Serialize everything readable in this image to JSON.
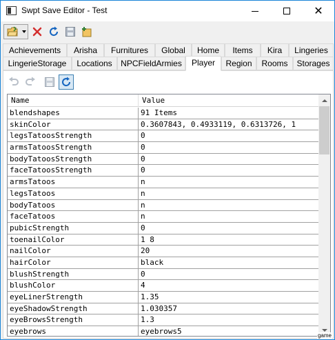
{
  "window": {
    "title": "Swpt Save Editor - Test",
    "controls": {
      "minimize": "minimize",
      "maximize": "maximize",
      "close": "✕"
    }
  },
  "toolbar": {
    "buttons": [
      "open-icon",
      "close-icon",
      "refresh-icon",
      "save-icon",
      "new-icon"
    ]
  },
  "tabs": {
    "row1": [
      "Achievements",
      "Arisha",
      "Furnitures",
      "Global",
      "Home",
      "Items",
      "Kira",
      "Lingeries"
    ],
    "row2": [
      "LingerieStorage",
      "Locations",
      "NPCFieldArmies",
      "Player",
      "Region",
      "Rooms",
      "Storages"
    ],
    "active": "Player"
  },
  "grid": {
    "columns": {
      "name": "Name",
      "value": "Value"
    },
    "rows": [
      {
        "name": "blendshapes",
        "value": "91 Items"
      },
      {
        "name": "skinColor",
        "value": "0.3607843, 0.4933119, 0.6313726, 1"
      },
      {
        "name": "legsTatoosStrength",
        "value": "0"
      },
      {
        "name": "armsTatoosStrength",
        "value": "0"
      },
      {
        "name": "bodyTatoosStrength",
        "value": "0"
      },
      {
        "name": "faceTatoosStrength",
        "value": "0"
      },
      {
        "name": "armsTatoos",
        "value": "n"
      },
      {
        "name": "legsTatoos",
        "value": "n"
      },
      {
        "name": "bodyTatoos",
        "value": "n"
      },
      {
        "name": "faceTatoos",
        "value": "n"
      },
      {
        "name": "pubicStrength",
        "value": "0"
      },
      {
        "name": "toenailColor",
        "value": "1 8"
      },
      {
        "name": "nailColor",
        "value": "20"
      },
      {
        "name": "hairColor",
        "value": "black"
      },
      {
        "name": "blushStrength",
        "value": "0"
      },
      {
        "name": "blushColor",
        "value": "4"
      },
      {
        "name": "eyeLinerStrength",
        "value": "1.35"
      },
      {
        "name": "eyeShadowStrength",
        "value": "1.030357"
      },
      {
        "name": "eyeBrowsStrength",
        "value": "1.3"
      },
      {
        "name": "eyebrows",
        "value": "eyebrows5"
      }
    ]
  },
  "watermark": "game",
  "colors": {
    "accent": "#1883d7",
    "grid_border": "#a0a0a0"
  }
}
